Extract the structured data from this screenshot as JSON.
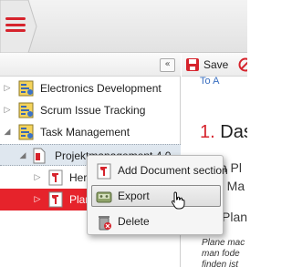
{
  "header": {
    "menu_icon": "hamburger-icon",
    "accent": "#d6232c"
  },
  "tree": {
    "collapse_icon": "double-chevron-left-icon",
    "items": [
      {
        "label": "Electronics Development",
        "icon": "project-icon"
      },
      {
        "label": "Scrum Issue Tracking",
        "icon": "project-icon"
      },
      {
        "label": "Task Management",
        "icon": "project-icon"
      },
      {
        "label": "Projektmanagement 4.0",
        "icon": "document-icon"
      },
      {
        "label": "Herr",
        "icon": "section-icon"
      },
      {
        "label": "Plane",
        "icon": "section-icon"
      }
    ]
  },
  "editor": {
    "save_label": "Save",
    "cancel_icon": "cancel-icon",
    "link_text": "To A",
    "heading_number": "1.",
    "heading_text": "Das",
    "body_lines": [
      "m Pl",
      "n Ma",
      "Plan"
    ],
    "italic_lines": [
      "Plane mac",
      "man fode",
      "finden ist"
    ]
  },
  "context_menu": {
    "items": [
      {
        "label": "Add Document section",
        "icon": "document-section-icon"
      },
      {
        "label": "Export",
        "icon": "export-icon"
      },
      {
        "label": "Delete",
        "icon": "trash-icon"
      }
    ]
  },
  "colors": {
    "selection": "#e6232b",
    "brand_red": "#d6232c"
  }
}
